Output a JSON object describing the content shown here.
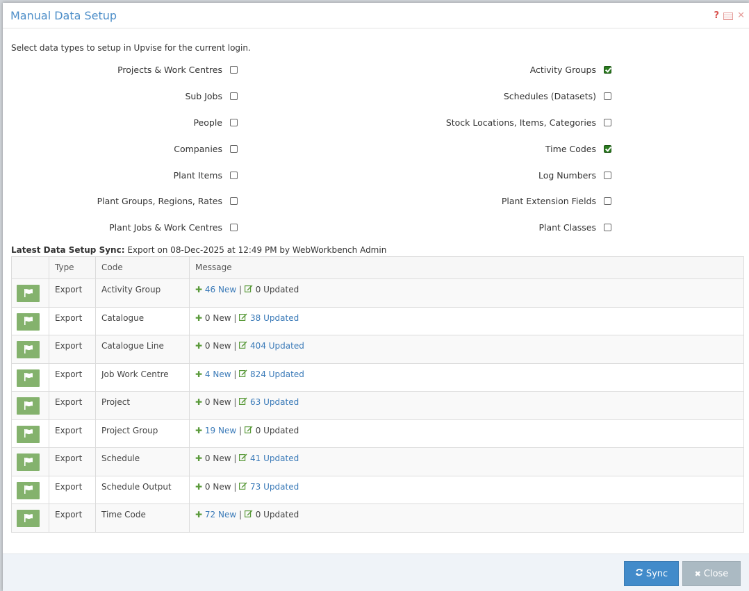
{
  "dialog": {
    "title": "Manual Data Setup",
    "icons": [
      "help-icon",
      "document-icon",
      "close-icon"
    ]
  },
  "intro_text": "Select data types to setup in Upvise for the current login.",
  "options_left": [
    {
      "label": "Projects & Work Centres",
      "checked": false
    },
    {
      "label": "Sub Jobs",
      "checked": false
    },
    {
      "label": "People",
      "checked": false
    },
    {
      "label": "Companies",
      "checked": false
    },
    {
      "label": "Plant Items",
      "checked": false
    },
    {
      "label": "Plant Groups, Regions, Rates",
      "checked": false
    },
    {
      "label": "Plant Jobs & Work Centres",
      "checked": false
    }
  ],
  "options_right": [
    {
      "label": "Activity Groups",
      "checked": true
    },
    {
      "label": "Schedules (Datasets)",
      "checked": false
    },
    {
      "label": "Stock Locations, Items, Categories",
      "checked": false
    },
    {
      "label": "Time Codes",
      "checked": true
    },
    {
      "label": "Log Numbers",
      "checked": false
    },
    {
      "label": "Plant Extension Fields",
      "checked": false
    },
    {
      "label": "Plant Classes",
      "checked": false
    }
  ],
  "sync": {
    "label": "Latest Data Setup Sync:",
    "value": "Export on 08-Dec-2025 at 12:49 PM by WebWorkbench Admin"
  },
  "table": {
    "headers": [
      "",
      "Type",
      "Code",
      "Message"
    ],
    "rows": [
      {
        "type": "Export",
        "code": "Activity Group",
        "new_text": "46 New",
        "new_link": true,
        "updated_text": "0 Updated",
        "updated_link": false
      },
      {
        "type": "Export",
        "code": "Catalogue",
        "new_text": "0 New",
        "new_link": false,
        "updated_text": "38 Updated",
        "updated_link": true
      },
      {
        "type": "Export",
        "code": "Catalogue Line",
        "new_text": "0 New",
        "new_link": false,
        "updated_text": "404 Updated",
        "updated_link": true
      },
      {
        "type": "Export",
        "code": "Job Work Centre",
        "new_text": "4 New",
        "new_link": true,
        "updated_text": "824 Updated",
        "updated_link": true
      },
      {
        "type": "Export",
        "code": "Project",
        "new_text": "0 New",
        "new_link": false,
        "updated_text": "63 Updated",
        "updated_link": true
      },
      {
        "type": "Export",
        "code": "Project Group",
        "new_text": "19 New",
        "new_link": true,
        "updated_text": "0 Updated",
        "updated_link": false
      },
      {
        "type": "Export",
        "code": "Schedule",
        "new_text": "0 New",
        "new_link": false,
        "updated_text": "41 Updated",
        "updated_link": true
      },
      {
        "type": "Export",
        "code": "Schedule Output",
        "new_text": "0 New",
        "new_link": false,
        "updated_text": "73 Updated",
        "updated_link": true
      },
      {
        "type": "Export",
        "code": "Time Code",
        "new_text": "72 New",
        "new_link": true,
        "updated_text": "0 Updated",
        "updated_link": false
      }
    ]
  },
  "footer": {
    "sync_label": "Sync",
    "close_label": "Close"
  },
  "colors": {
    "title": "#4f8fc9",
    "link": "#3a7ab8",
    "flag_button": "#84b26d",
    "checked": "#2a7a1f",
    "sync_button": "#428bca",
    "close_button": "#abbac3"
  }
}
